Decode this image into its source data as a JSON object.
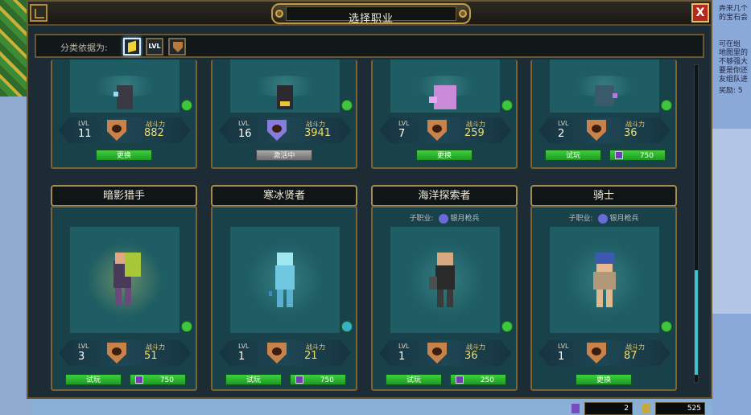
{
  "window": {
    "title": "选择职业",
    "close_label": "X"
  },
  "filter": {
    "label": "分类依据为:",
    "buttons": [
      {
        "name": "cube",
        "label": ""
      },
      {
        "name": "level",
        "label": "LVL"
      },
      {
        "name": "rank",
        "label": ""
      }
    ]
  },
  "side_text": [
    "弄来几个",
    "的宝石会",
    "可在组",
    "地图里的",
    "不够强大",
    "要是你还",
    "友组队进",
    "奖励: 5"
  ],
  "stat_labels": {
    "level": "LVL",
    "power": "战斗力"
  },
  "top_cards": [
    {
      "level": "11",
      "power": "882",
      "action": "更换",
      "style": "green"
    },
    {
      "level": "16",
      "power": "3941",
      "action": "激活中",
      "style": "gray"
    },
    {
      "level": "7",
      "power": "259",
      "action": "更换",
      "style": "green"
    },
    {
      "level": "2",
      "power": "36",
      "action": "试玩",
      "cost": "750",
      "style": "trial"
    }
  ],
  "cards": [
    {
      "name": "暗影猎手",
      "subjob_label": "",
      "subjob": "",
      "level": "3",
      "power": "51",
      "action": "试玩",
      "cost": "750"
    },
    {
      "name": "寒冰贤者",
      "subjob_label": "",
      "subjob": "",
      "level": "1",
      "power": "21",
      "action": "试玩",
      "cost": "750"
    },
    {
      "name": "海洋探索者",
      "subjob_label": "子职业:",
      "subjob": "银月枪兵",
      "level": "1",
      "power": "36",
      "action": "试玩",
      "cost": "250"
    },
    {
      "name": "骑士",
      "subjob_label": "子职业:",
      "subjob": "银月枪兵",
      "level": "1",
      "power": "87",
      "action": "更换",
      "cost": ""
    }
  ],
  "currency": {
    "cubits": "2",
    "glim": "525"
  },
  "colors": {
    "accent_gold": "#c09a48",
    "button_green": "#2fb82f",
    "panel_teal": "#19414a"
  }
}
